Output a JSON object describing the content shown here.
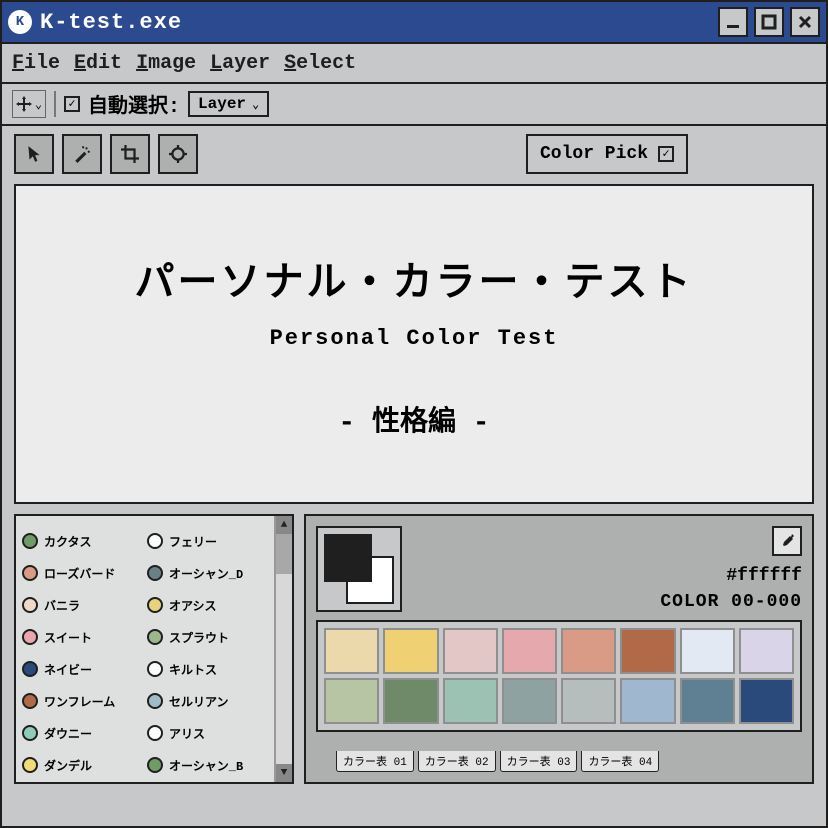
{
  "window": {
    "title": "K-test.exe"
  },
  "menubar": [
    "File",
    "Edit",
    "Image",
    "Layer",
    "Select"
  ],
  "optionbar": {
    "auto_select_label": "自動選択:",
    "layer_dropdown": "Layer"
  },
  "color_pick_label": "Color Pick",
  "hero": {
    "title_ja": "パーソナル・カラー・テスト",
    "title_en": "Personal Color Test",
    "kind": "- 性格編 -"
  },
  "color_list": [
    {
      "name": "カクタス",
      "color": "#6f9c66"
    },
    {
      "name": "フェリー",
      "color": "#ffffff"
    },
    {
      "name": "ローズバード",
      "color": "#d99b86"
    },
    {
      "name": "オーシャン_D",
      "color": "#6a8086"
    },
    {
      "name": "バニラ",
      "color": "#efd9c8"
    },
    {
      "name": "オアシス",
      "color": "#e6d37b"
    },
    {
      "name": "スイート",
      "color": "#e9a6af"
    },
    {
      "name": "スプラウト",
      "color": "#9cb88b"
    },
    {
      "name": "ネイビー",
      "color": "#294a7a"
    },
    {
      "name": "キルトス",
      "color": "#ffffff"
    },
    {
      "name": "ワンフレーム",
      "color": "#b06a48"
    },
    {
      "name": "セルリアン",
      "color": "#9fbcc7"
    },
    {
      "name": "ダウニー",
      "color": "#8fcabb"
    },
    {
      "name": "アリス",
      "color": "#ffffff"
    },
    {
      "name": "ダンデル",
      "color": "#f1dc78"
    },
    {
      "name": "オーシャン_B",
      "color": "#6f9c66"
    }
  ],
  "picker": {
    "hex": "#ffffff",
    "color_id": "COLOR 00-000",
    "palette": [
      "#ecd9ab",
      "#efd173",
      "#e3c7c7",
      "#e5a9ad",
      "#d99b86",
      "#b06a48",
      "#e2e9f2",
      "#d9d4e8",
      "#b8c5a5",
      "#6f8a68",
      "#9bc2b3",
      "#8ea2a2",
      "#b5bdbd",
      "#9fb8cf",
      "#5f7f92",
      "#294a7a"
    ],
    "tabs": [
      "カラー表 01",
      "カラー表 02",
      "カラー表 03",
      "カラー表 04"
    ]
  }
}
